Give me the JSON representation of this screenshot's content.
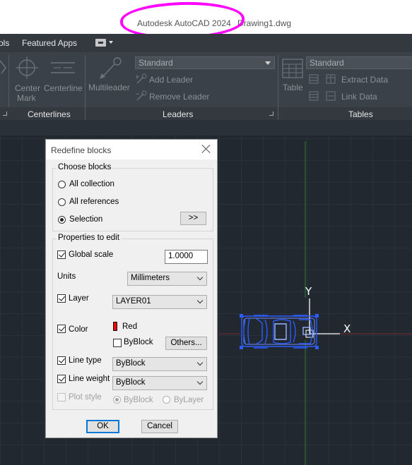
{
  "window": {
    "app_title": "Autodesk AutoCAD 2024",
    "file_name": "Drawing1.dwg"
  },
  "tabs": {
    "partial": "ols",
    "featured": "Featured Apps"
  },
  "ribbon": {
    "centerlines_panel": {
      "title": "Centerlines",
      "center_mark_line1": "Center",
      "center_mark_line2": "Mark",
      "centerline": "Centerline"
    },
    "leaders_panel": {
      "title": "Leaders",
      "multileader": "Multileader",
      "style_value": "Standard",
      "add_leader": "Add Leader",
      "remove_leader": "Remove Leader"
    },
    "tables_panel": {
      "title": "Tables",
      "table": "Table",
      "style_value": "Standard",
      "extract_data": "Extract Data",
      "link_data": "Link Data"
    }
  },
  "canvas": {
    "ucs_y": "Y",
    "ucs_x": "X"
  },
  "dialog": {
    "title": "Redefine blocks",
    "choose_blocks": {
      "label": "Choose blocks",
      "all_collection": "All collection",
      "all_references": "All references",
      "selection": "Selection",
      "selected": "selection",
      "pick_button": ">>"
    },
    "properties": {
      "label": "Properties to edit",
      "global_scale_label": "Global scale",
      "global_scale_checked": true,
      "global_scale_value": "1.0000",
      "units_label": "Units",
      "units_value": "Millimeters",
      "layer_label": "Layer",
      "layer_checked": true,
      "layer_value": "LAYER01",
      "color_label": "Color",
      "color_checked": true,
      "color_value": "Red",
      "color_hex": "#ff0000",
      "byblock_label": "ByBlock",
      "byblock_checked": false,
      "others_button": "Others...",
      "linetype_label": "Line type",
      "linetype_checked": true,
      "linetype_value": "ByBlock",
      "lineweight_label": "Line weight",
      "lineweight_checked": true,
      "lineweight_value": "ByBlock",
      "plotstyle_label": "Plot style",
      "plotstyle_checked": false,
      "plotstyle_byblock": "ByBlock",
      "plotstyle_bylayer": "ByLayer"
    },
    "ok": "OK",
    "cancel": "Cancel"
  },
  "colors": {
    "highlight": "#ff00ff",
    "selection_blue": "#2a5cff",
    "ucs_green": "#2f7d2f",
    "ucs_red": "#7a2a2a"
  }
}
